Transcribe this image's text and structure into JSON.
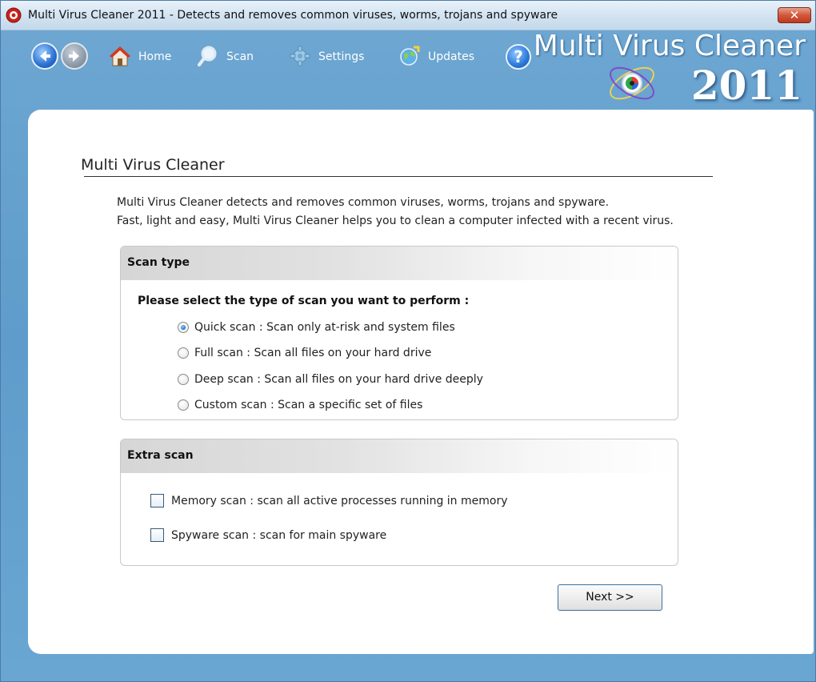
{
  "window": {
    "title": "Multi Virus Cleaner 2011 - Detects and removes common viruses, worms, trojans and spyware",
    "close_label": "✕"
  },
  "toolbar": {
    "items": [
      {
        "label": "Home",
        "icon": "home-icon"
      },
      {
        "label": "Scan",
        "icon": "magnifier-icon"
      },
      {
        "label": "Settings",
        "icon": "gear-icon"
      },
      {
        "label": "Updates",
        "icon": "globe-update-icon"
      }
    ],
    "help_label": "?"
  },
  "brand": {
    "name": "Multi Virus Cleaner",
    "year": "2011"
  },
  "page": {
    "title": "Multi Virus Cleaner",
    "intro_line1": "Multi Virus Cleaner detects and removes common viruses, worms, trojans and spyware.",
    "intro_line2": "Fast, light and easy, Multi Virus Cleaner helps you to clean a computer infected with a recent virus."
  },
  "scan_type": {
    "heading": "Scan type",
    "prompt": "Please select the type of scan you want to perform :",
    "options": [
      {
        "label": "Quick scan :  Scan only at-risk and system files",
        "checked": true
      },
      {
        "label": "Full scan : Scan all files on your hard drive",
        "checked": false
      },
      {
        "label": "Deep scan : Scan all files on your hard drive deeply",
        "checked": false
      },
      {
        "label": "Custom scan : Scan a specific set of files",
        "checked": false
      }
    ]
  },
  "extra_scan": {
    "heading": "Extra scan",
    "options": [
      {
        "label": "Memory scan : scan all active processes running in memory",
        "checked": false
      },
      {
        "label": "Spyware scan : scan for main spyware",
        "checked": false
      }
    ]
  },
  "footer": {
    "next_label": "Next >>"
  },
  "colors": {
    "frame_blue": "#6ea7d2",
    "title_bar": "#d3e4f2",
    "close_red": "#c0391f",
    "selection_blue": "#1f6ac4"
  }
}
